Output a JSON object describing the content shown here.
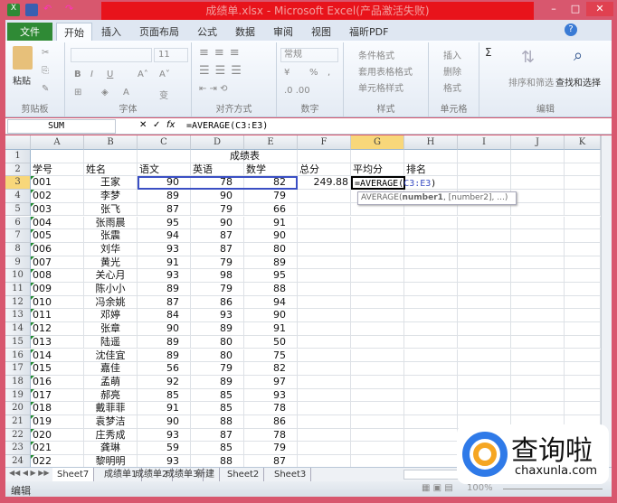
{
  "window": {
    "title": "成绩单.xlsx - Microsoft Excel(产品激活失败)",
    "minimize": "–",
    "maximize": "□",
    "close": "✕"
  },
  "tabs": [
    "文件",
    "开始",
    "插入",
    "页面布局",
    "公式",
    "数据",
    "审阅",
    "视图",
    "福昕PDF"
  ],
  "ribbon": {
    "clipboard": {
      "paste": "粘贴",
      "label": "剪贴板"
    },
    "font": {
      "size": "11",
      "bold": "B",
      "italic": "I",
      "underline": "U",
      "grow": "A˄",
      "shrink": "A˅",
      "color": "A",
      "phonetic": "变",
      "label": "字体"
    },
    "alignment": {
      "label": "对齐方式"
    },
    "number": {
      "format": "常规",
      "percent": "%",
      "comma": ",",
      "label": "数字"
    },
    "styles": {
      "conditional": "条件格式",
      "table": "套用表格格式",
      "cell": "单元格样式",
      "label": "样式"
    },
    "cells": {
      "insert": "插入",
      "delete": "删除",
      "format": "格式",
      "label": "单元格"
    },
    "editing": {
      "sum": "Σ",
      "sort": "排序和筛选",
      "find": "查找和选择",
      "label": "编辑"
    }
  },
  "formula_bar": {
    "name_box": "SUM",
    "fx": "fx",
    "cancel": "✕",
    "enter": "✓",
    "formula": "=AVERAGE(C3:E3)"
  },
  "columns": [
    "A",
    "B",
    "C",
    "D",
    "E",
    "F",
    "G",
    "H",
    "I",
    "J",
    "K"
  ],
  "selected_column": "G",
  "selected_row": 3,
  "sheet": {
    "title": "成绩表",
    "headers": [
      "学号",
      "姓名",
      "语文",
      "英语",
      "数学",
      "总分",
      "平均分",
      "排名"
    ],
    "rows": [
      [
        "001",
        "王家",
        "90",
        "78",
        "82",
        "249.88"
      ],
      [
        "002",
        "李梦",
        "89",
        "90",
        "79"
      ],
      [
        "003",
        "张飞",
        "87",
        "79",
        "66"
      ],
      [
        "004",
        "张雨晨",
        "95",
        "90",
        "91"
      ],
      [
        "005",
        "张震",
        "94",
        "87",
        "90"
      ],
      [
        "006",
        "刘华",
        "93",
        "87",
        "80"
      ],
      [
        "007",
        "黄光",
        "91",
        "79",
        "89"
      ],
      [
        "008",
        "关心月",
        "93",
        "98",
        "95"
      ],
      [
        "009",
        "陈小小",
        "89",
        "79",
        "88"
      ],
      [
        "010",
        "冯余姚",
        "87",
        "86",
        "94"
      ],
      [
        "011",
        "邓婷",
        "84",
        "93",
        "90"
      ],
      [
        "012",
        "张章",
        "90",
        "89",
        "91"
      ],
      [
        "013",
        "陆遥",
        "89",
        "80",
        "50"
      ],
      [
        "014",
        "沈佳宜",
        "89",
        "80",
        "75"
      ],
      [
        "015",
        "嘉佳",
        "56",
        "79",
        "82"
      ],
      [
        "016",
        "孟萌",
        "92",
        "89",
        "97"
      ],
      [
        "017",
        "郝亮",
        "85",
        "85",
        "93"
      ],
      [
        "018",
        "戴菲菲",
        "91",
        "85",
        "78"
      ],
      [
        "019",
        "袁梦洁",
        "90",
        "88",
        "86"
      ],
      [
        "020",
        "庄秀成",
        "93",
        "87",
        "78"
      ],
      [
        "021",
        "龚琳",
        "59",
        "85",
        "79"
      ],
      [
        "022",
        "黎明明",
        "93",
        "88",
        "87"
      ]
    ],
    "editing_cell": {
      "prefix": "=AVERAGE(",
      "ref": "C3:E3",
      "suffix": ")"
    },
    "tooltip": {
      "fn": "AVERAGE(",
      "arg1": "number1",
      "rest": ", [number2], ...)"
    }
  },
  "sheet_tabs": [
    "Sheet7",
    "成绩单1",
    "成绩单2",
    "成绩单3",
    "新建",
    "Sheet2",
    "Sheet3"
  ],
  "status": {
    "mode": "编辑",
    "zoom": "100%"
  },
  "watermark": {
    "name": "查询啦",
    "url": "chaxunla.com"
  },
  "colors": {
    "title_red": "#e8131b",
    "frame": "#d8576e",
    "file_tab": "#2f8a35",
    "selection": "#f8d77a",
    "ref_blue": "#3b4fc4"
  }
}
